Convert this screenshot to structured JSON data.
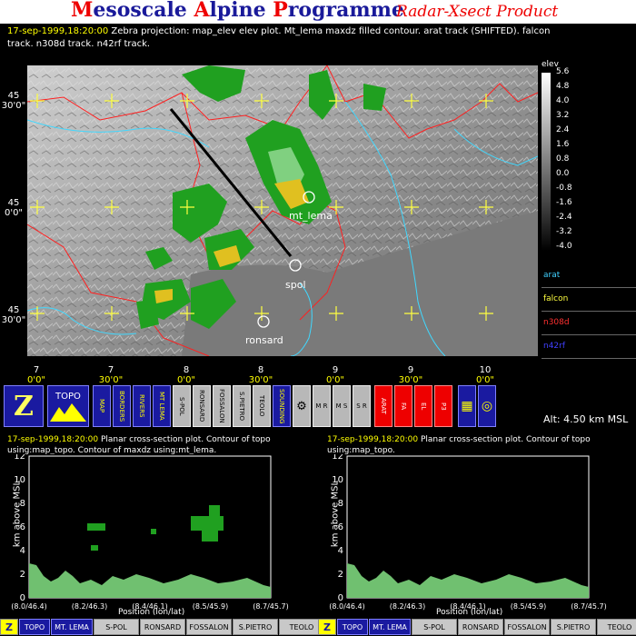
{
  "header": {
    "title_parts": [
      {
        "cap": "M",
        "rest": "esoscale "
      },
      {
        "cap": "A",
        "rest": "lpine "
      },
      {
        "cap": "P",
        "rest": "rogramme"
      }
    ],
    "subtitle": "Radar-Xsect Product"
  },
  "caption": {
    "timestamp": "17-sep-1999,18:20:00",
    "line1": "Zebra projection: map_elev elev plot.  Mt_lema maxdz filled contour.   arat track (SHIFTED).   falcon",
    "line2": "track.   n308d track.   n42rf track."
  },
  "legend": {
    "title": "elev",
    "ticks": [
      "5.6",
      "4.8",
      "4.0",
      "3.2",
      "2.4",
      "1.6",
      "0.8",
      "0.0",
      "-0.8",
      "-1.6",
      "-2.4",
      "-3.2",
      "-4.0"
    ],
    "tracks": [
      {
        "label": "arat",
        "color": "#40d0ff"
      },
      {
        "label": "falcon",
        "color": "#ffff40"
      },
      {
        "label": "n308d",
        "color": "#ff3030"
      },
      {
        "label": "n42rf",
        "color": "#4040ff"
      }
    ]
  },
  "map": {
    "stations": [
      {
        "label": "mt_lema"
      },
      {
        "label": "spol"
      },
      {
        "label": "ronsard"
      }
    ],
    "lat_labels": [
      {
        "deg": "45",
        "min": "30'0\""
      },
      {
        "deg": "45",
        "min": "0'0\""
      },
      {
        "deg": "45",
        "min": "30'0\""
      }
    ],
    "lon_labels": [
      {
        "deg": "7",
        "min": "0'0\""
      },
      {
        "deg": "7",
        "min": "30'0\""
      },
      {
        "deg": "8",
        "min": "0'0\""
      },
      {
        "deg": "8",
        "min": "30'0\""
      },
      {
        "deg": "9",
        "min": "0'0\""
      },
      {
        "deg": "9",
        "min": "30'0\""
      },
      {
        "deg": "10",
        "min": "0'0\""
      }
    ]
  },
  "toolbar": {
    "zebra": "Z",
    "topo": "TOPO",
    "buttons": [
      {
        "label": "MAP",
        "style": "blue"
      },
      {
        "label": "BORDERS",
        "style": "blue"
      },
      {
        "label": "RIVERS",
        "style": "blue"
      },
      {
        "label": "MT LEMA",
        "style": "blue"
      },
      {
        "label": "S-POL",
        "style": "gray"
      },
      {
        "label": "RONSARD",
        "style": "gray"
      },
      {
        "label": "FOSSALON",
        "style": "gray"
      },
      {
        "label": "S.PIETRO",
        "style": "gray"
      },
      {
        "label": "TEOLO",
        "style": "gray"
      },
      {
        "label": "SOUNDING",
        "style": "blue"
      }
    ],
    "circle_buttons": [
      "⚙",
      "M R",
      "M S",
      "S R"
    ],
    "aircraft": [
      {
        "label": "ARAT"
      },
      {
        "label": "FA"
      },
      {
        "label": "EL"
      },
      {
        "label": "P3"
      }
    ],
    "grid_icon": "▦",
    "target_icon": "◎"
  },
  "altitude": "Alt: 4.50 km MSL",
  "panels": [
    {
      "timestamp": "17-sep-1999,18:20:00",
      "caption": "Planar cross-section plot.  Contour of topo using:map_topo.  Contour of maxdz using:mt_lema.",
      "ylabel": "km above MSL",
      "xlabel": "Position (lon/lat)",
      "yticks": [
        "0",
        "2",
        "4",
        "6",
        "8",
        "10",
        "12"
      ],
      "xticks": [
        "(8.0/46.4)",
        "(8.2/46.3)",
        "(8.4/46.1)",
        "(8.5/45.9)",
        "(8.7/45.7)"
      ]
    },
    {
      "timestamp": "17-sep-1999,18:20:00",
      "caption": "Planar cross-section plot.  Contour of topo using:map_topo.",
      "ylabel": "km above MSL",
      "xlabel": "Position (lon/lat)",
      "yticks": [
        "0",
        "2",
        "4",
        "6",
        "8",
        "10",
        "12"
      ],
      "xticks": [
        "(8.0/46.4)",
        "(8.2/46.3)",
        "(8.4/46.1)",
        "(8.5/45.9)",
        "(8.7/45.7)"
      ]
    }
  ],
  "bottom_bar": {
    "left": [
      "Z",
      "TOPO",
      "MT. LEMA",
      "S-POL",
      "RONSARD",
      "FOSSALON",
      "S.PIETRO",
      "TEOLO"
    ],
    "right": [
      "Z",
      "TOPO",
      "MT. LEMA",
      "S-POL",
      "RONSARD",
      "FOSSALON",
      "S.PIETRO",
      "TEOLO"
    ]
  },
  "colors": {
    "title_blue": "#1a1a9a",
    "title_red": "#e00000",
    "timestamp_yellow": "#ffff00",
    "echo_green": "#20a020",
    "echo_yellow": "#e0c020",
    "topo_green": "#70c070"
  }
}
